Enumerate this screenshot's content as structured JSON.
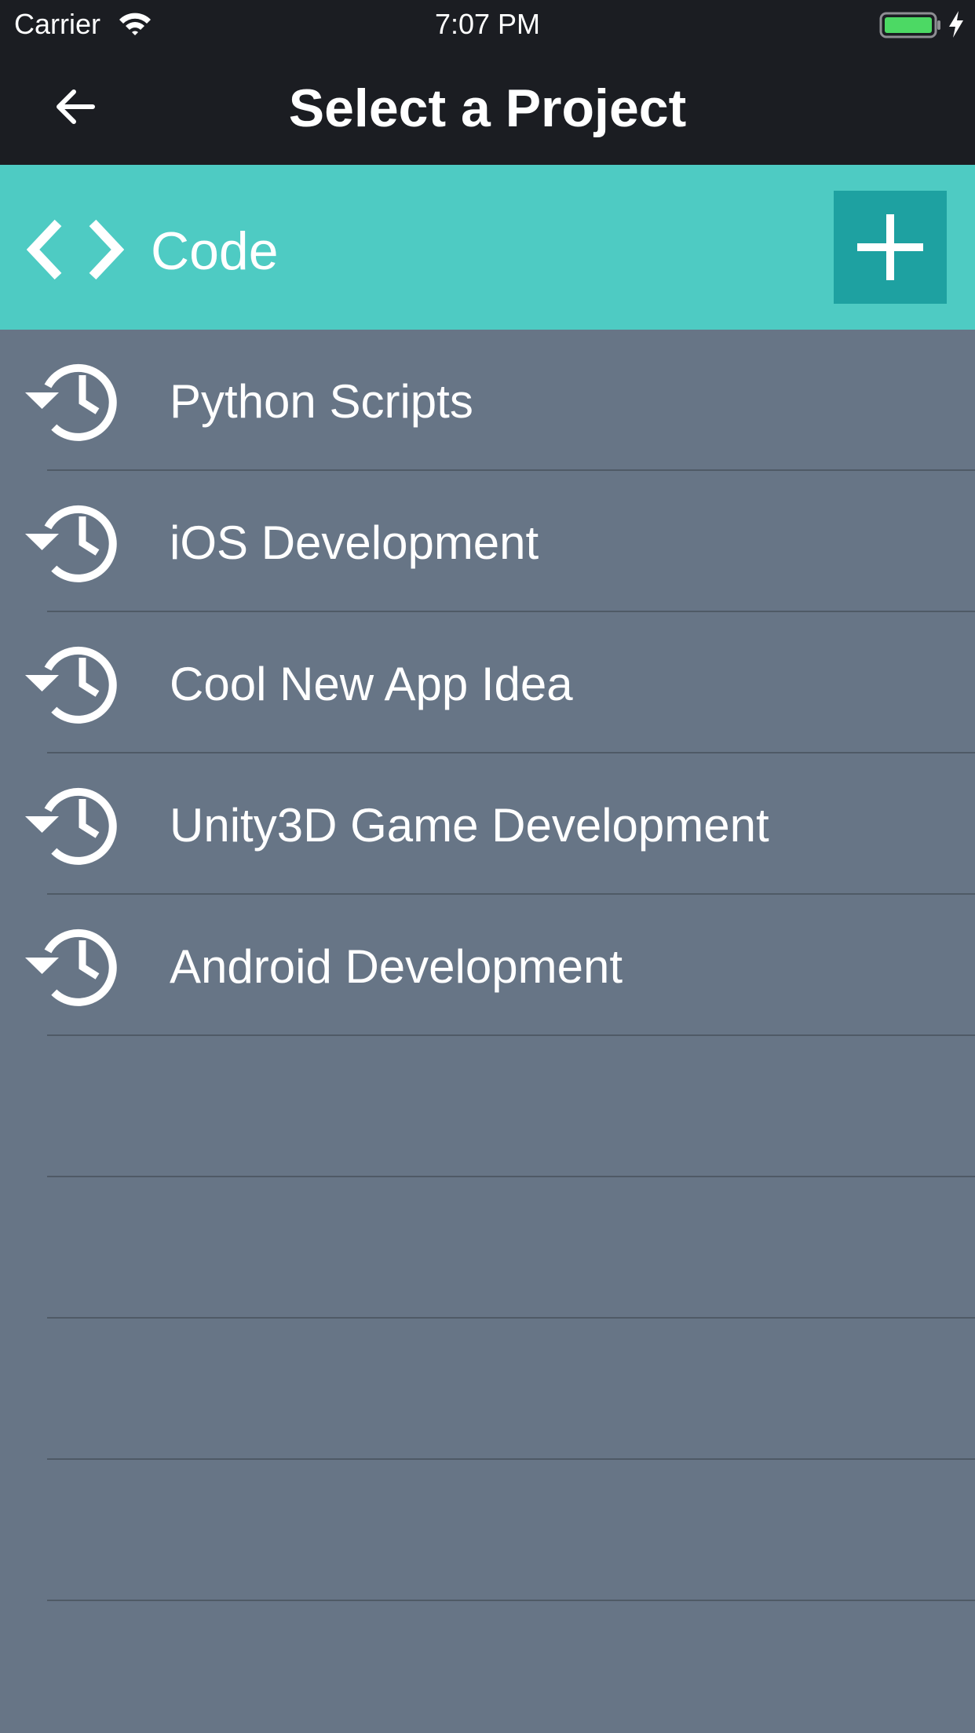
{
  "status_bar": {
    "carrier": "Carrier",
    "time": "7:07 PM",
    "icons": [
      "wifi-icon",
      "battery-icon",
      "charging-bolt-icon"
    ]
  },
  "nav_bar": {
    "title": "Select a Project",
    "back_icon": "arrow-left-icon"
  },
  "category": {
    "label": "Code",
    "icon": "code-brackets-icon",
    "add_icon": "plus-icon"
  },
  "projects": [
    {
      "label": "Python Scripts",
      "icon": "history-icon"
    },
    {
      "label": "iOS Development",
      "icon": "history-icon"
    },
    {
      "label": "Cool New App Idea",
      "icon": "history-icon"
    },
    {
      "label": "Unity3D Game Development",
      "icon": "history-icon"
    },
    {
      "label": "Android Development",
      "icon": "history-icon"
    },
    {
      "label": ""
    },
    {
      "label": ""
    },
    {
      "label": ""
    },
    {
      "label": ""
    }
  ],
  "colors": {
    "bar_background": "#1b1d22",
    "category_background": "#4ecbc3",
    "add_button_background": "#1ea1a1",
    "list_background": "#677586",
    "battery_fill": "#4cd964"
  }
}
